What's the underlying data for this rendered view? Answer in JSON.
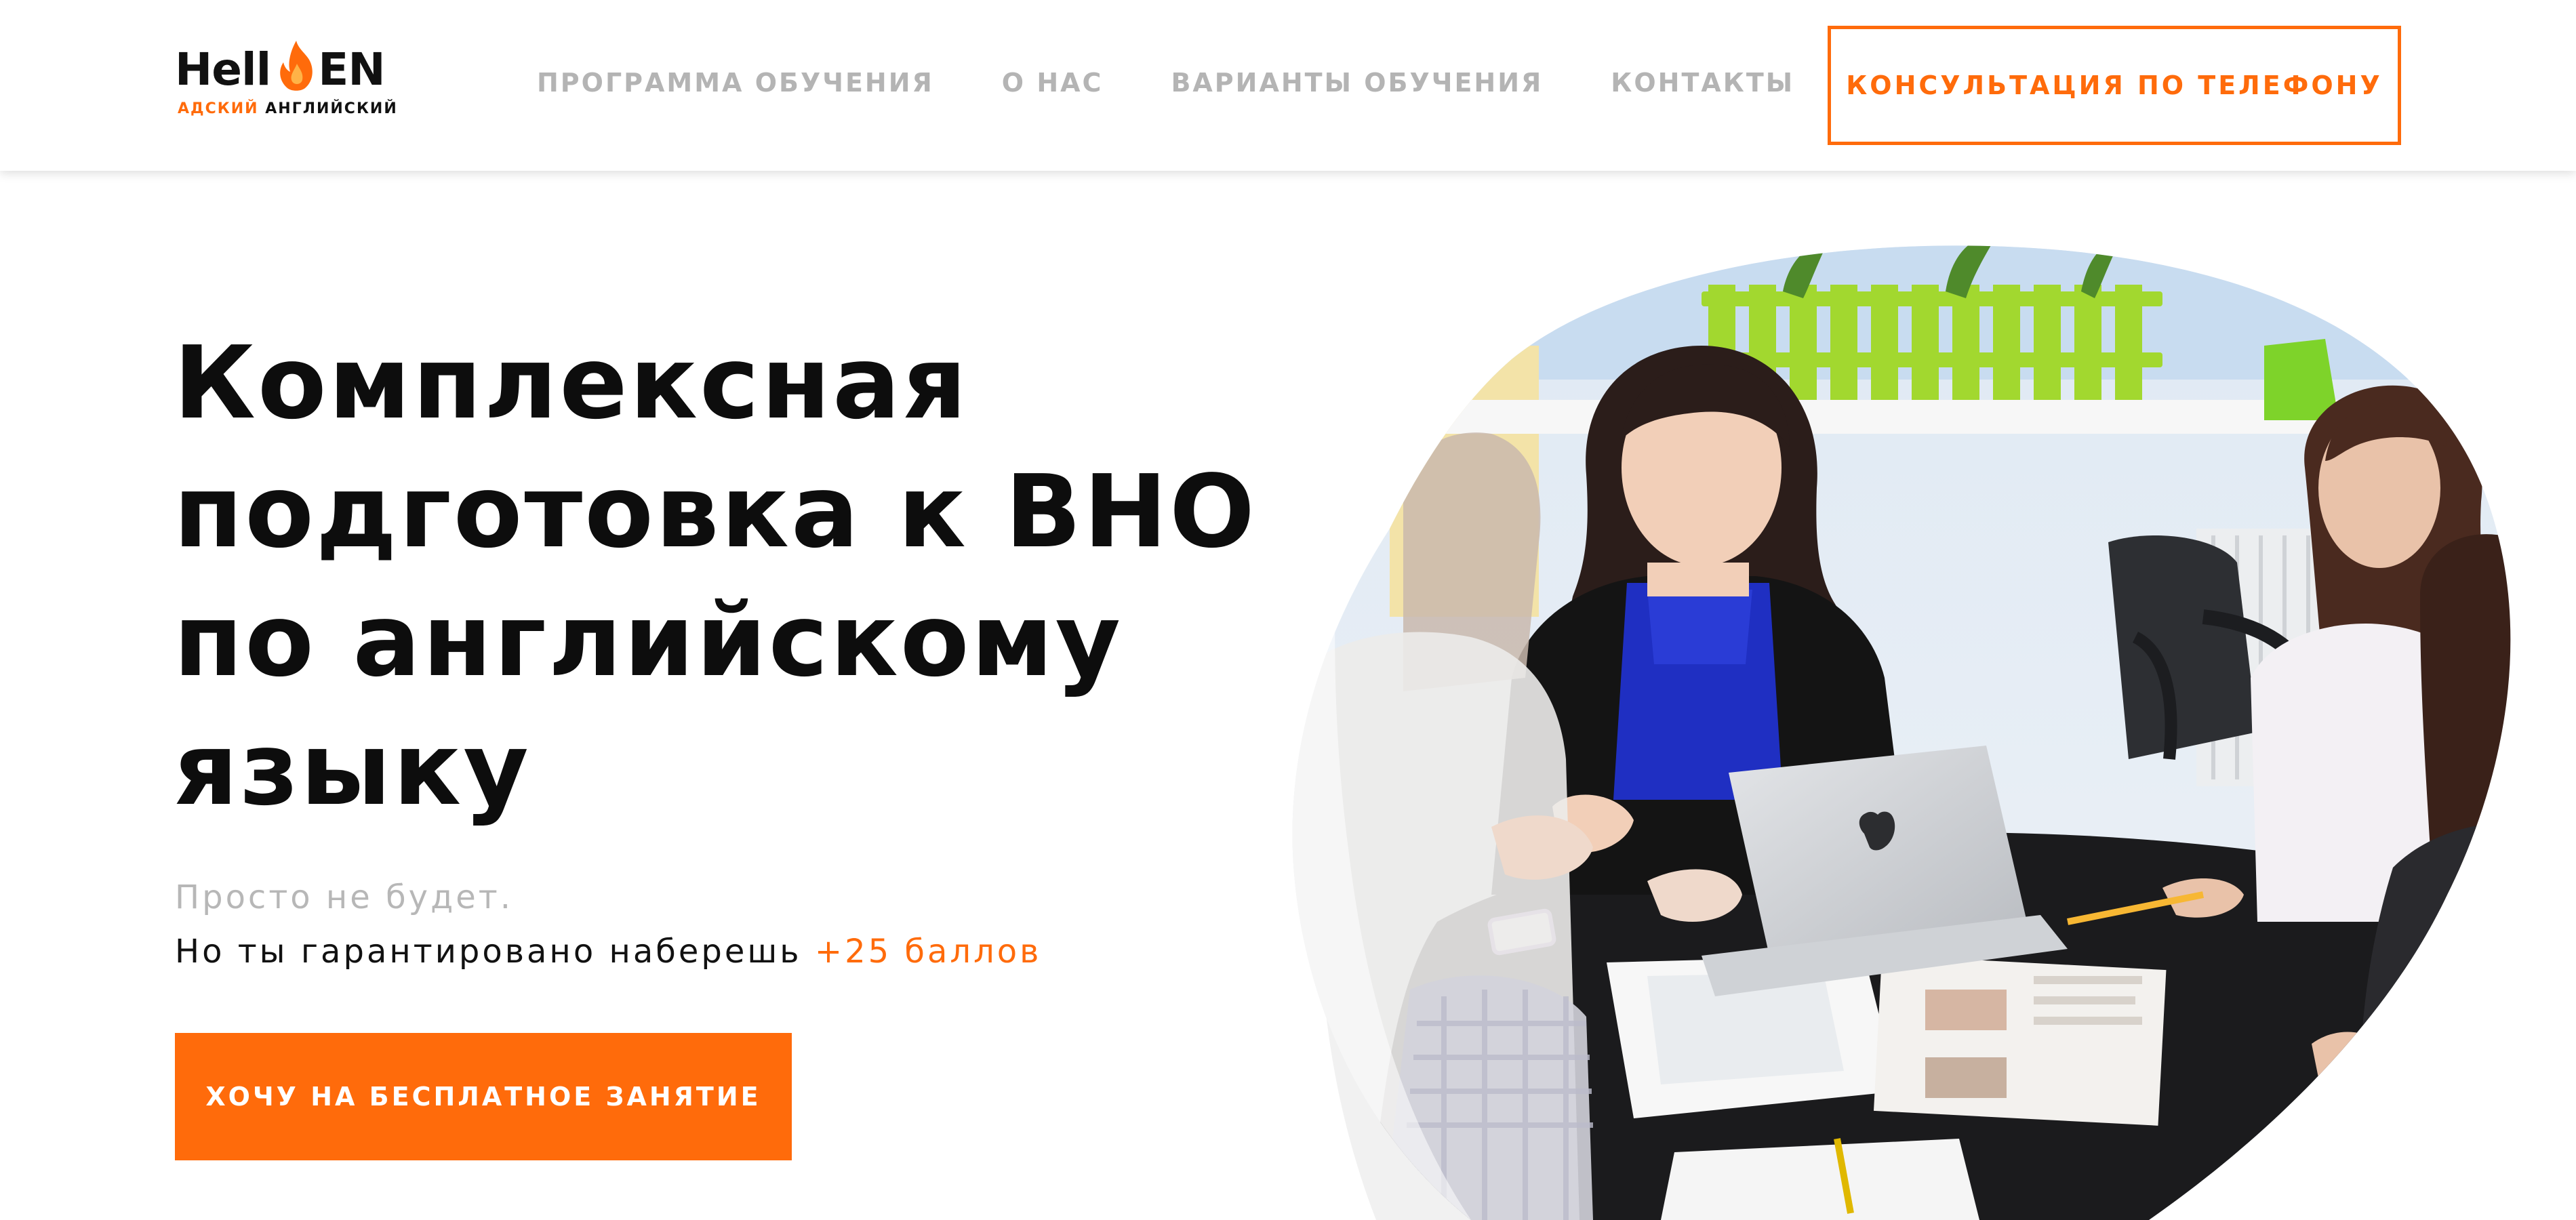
{
  "brand": {
    "logo_part1": "Hell",
    "logo_part2": "EN",
    "tagline_accent": "АДСКИЙ",
    "tagline_rest": "АНГЛИЙСКИЙ",
    "accent_color": "#ff6b0b",
    "flame_icon": "flame-icon"
  },
  "nav": {
    "items": [
      "ПРОГРАММА ОБУЧЕНИЯ",
      "О НАС",
      "ВАРИАНТЫ ОБУЧЕНИЯ",
      "КОНТАКТЫ"
    ],
    "phone_button": "КОНСУЛЬТАЦИЯ ПО ТЕЛЕФОНУ"
  },
  "hero": {
    "title_lines": [
      "Комплексная",
      "подготовка к ВНО",
      "по английскому",
      "языку"
    ],
    "subtitle_muted": "Просто не будет.",
    "subtitle_prefix": "Но ты гарантировано наберешь",
    "subtitle_highlight": "+25 баллов",
    "cta_label": "ХОЧУ НА БЕСПЛАТНОЕ ЗАНЯТИЕ"
  },
  "photo": {
    "subject": "group-lesson-photo",
    "mask": "blob-shape"
  }
}
